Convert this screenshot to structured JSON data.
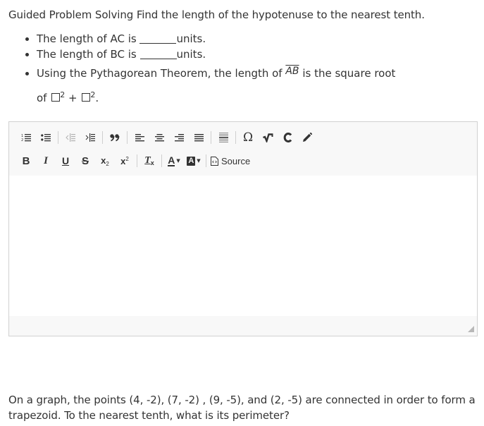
{
  "question1": {
    "title": "Guided Problem Solving Find the length of the hypotenuse to the nearest tenth.",
    "bullets": [
      {
        "prefix": "The length of AC is ",
        "suffix": "units."
      },
      {
        "prefix": "The length of BC is ",
        "suffix": "units."
      },
      {
        "prefix": "Using the Pythagorean Theorem, the length of ",
        "segment": "AB",
        "suffix": " is the square root",
        "line2_prefix": "of ",
        "exponent": "2",
        "operator": " + ",
        "line2_suffix": "."
      }
    ]
  },
  "editor": {
    "toolbar_row1": [
      {
        "name": "numbered-list-button",
        "icon": "numbered-list-icon",
        "label": "Insert/Remove Numbered List"
      },
      {
        "name": "bulleted-list-button",
        "icon": "bulleted-list-icon",
        "label": "Insert/Remove Bulleted List"
      },
      {
        "name": "decrease-indent-button",
        "icon": "outdent-icon",
        "label": "Decrease Indent",
        "disabled": true
      },
      {
        "name": "increase-indent-button",
        "icon": "indent-icon",
        "label": "Increase Indent"
      },
      {
        "name": "blockquote-button",
        "icon": "quote-icon",
        "label": "Block Quote"
      },
      {
        "name": "align-left-button",
        "icon": "align-left-icon",
        "label": "Align Left"
      },
      {
        "name": "align-center-button",
        "icon": "align-center-icon",
        "label": "Center"
      },
      {
        "name": "align-right-button",
        "icon": "align-right-icon",
        "label": "Align Right"
      },
      {
        "name": "justify-button",
        "icon": "align-justify-icon",
        "label": "Justify"
      },
      {
        "name": "horizontal-line-button",
        "icon": "horizontal-line-icon",
        "label": "Insert Horizontal Line"
      },
      {
        "name": "special-char-button",
        "icon": "omega-icon",
        "glyph": "Ω",
        "label": "Insert Special Character"
      },
      {
        "name": "math-button",
        "icon": "square-root-icon",
        "label": "Math"
      },
      {
        "name": "chemistry-button",
        "icon": "chemistry-c-icon",
        "label": "Chemistry"
      },
      {
        "name": "draw-button",
        "icon": "pencil-icon",
        "label": "Draw"
      }
    ],
    "toolbar_row2": {
      "bold": "B",
      "italic": "I",
      "underline": "U",
      "strike": "S",
      "subscript_base": "x",
      "subscript_index": "2",
      "superscript_base": "x",
      "superscript_index": "2",
      "remove_format": "T",
      "remove_format_sub": "x",
      "text_color": "A",
      "bg_color": "A",
      "source_label": "Source"
    },
    "content": ""
  },
  "question2": {
    "text": "On a graph, the points (4, -2), (7, -2) , (9, -5), and (2, -5) are connected in order to form a trapezoid. To the nearest tenth, what is its perimeter?"
  },
  "colors": {
    "text": "#333333",
    "border": "#d1d1d1",
    "toolbar_bg": "#f8f8f8"
  }
}
